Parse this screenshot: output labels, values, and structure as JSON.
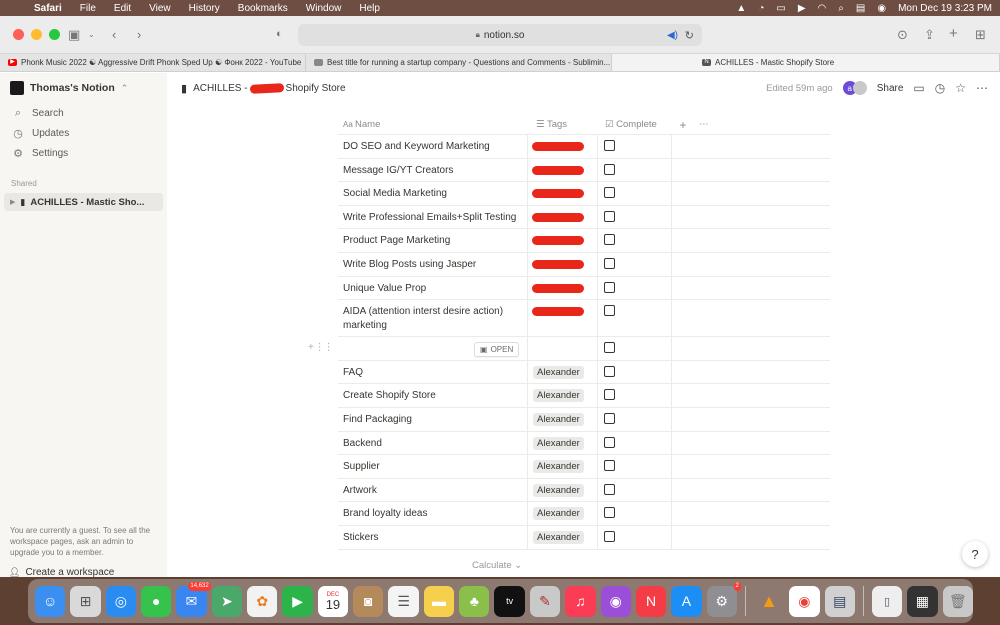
{
  "menubar": {
    "app": "Safari",
    "items": [
      "File",
      "Edit",
      "View",
      "History",
      "Bookmarks",
      "Window",
      "Help"
    ],
    "datetime": "Mon Dec 19  3:23 PM"
  },
  "browser": {
    "url": "notion.so",
    "tabs": [
      {
        "title": "Phonk Music 2022 ☯ Aggressive Drift Phonk Sped Up ☯ Фонк 2022 - YouTube",
        "favicon": "youtube-icon",
        "color": "#ff0000"
      },
      {
        "title": "Best title for running a startup company - Questions and Comments - Sublimin...",
        "favicon": "forum-icon",
        "color": "#888888"
      },
      {
        "title": "ACHILLES - Mastic Shopify Store",
        "favicon": "notion-icon",
        "color": "#555555"
      }
    ]
  },
  "sidebar": {
    "workspace": "Thomas's Notion",
    "items": [
      {
        "label": "Search",
        "icon": "search-icon"
      },
      {
        "label": "Updates",
        "icon": "clock-icon"
      },
      {
        "label": "Settings",
        "icon": "gear-icon"
      }
    ],
    "shared_label": "Shared",
    "shared_page": "ACHILLES - Mastic Sho...",
    "guest_note": "You are currently a guest. To see all the workspace pages, ask an admin to upgrade you to a member.",
    "create_workspace": "Create a workspace"
  },
  "page": {
    "breadcrumb_left": "ACHILLES -",
    "breadcrumb_right": "Shopify Store",
    "edited": "Edited 59m ago",
    "avatar_letter": "a",
    "share": "Share"
  },
  "table": {
    "columns": {
      "name": "Name",
      "tags": "Tags",
      "complete": "Complete"
    },
    "open_label": "OPEN",
    "rows": [
      {
        "name": "DO SEO and Keyword Marketing",
        "tag": "",
        "redacted": true
      },
      {
        "name": "Message IG/YT Creators",
        "tag": "",
        "redacted": true
      },
      {
        "name": "Social Media Marketing",
        "tag": "",
        "redacted": true
      },
      {
        "name": "Write Professional Emails+Split Testing",
        "tag": "",
        "redacted": true
      },
      {
        "name": "Product Page Marketing",
        "tag": "",
        "redacted": true
      },
      {
        "name": "Write Blog Posts using Jasper",
        "tag": "",
        "redacted": true
      },
      {
        "name": "Unique Value Prop",
        "tag": "",
        "redacted": true
      },
      {
        "name": "AIDA (attention interst desire action) marketing",
        "tag": "",
        "redacted": true
      },
      {
        "name": "FAQ",
        "tag": "Alexander"
      },
      {
        "name": "Create Shopify Store",
        "tag": "Alexander"
      },
      {
        "name": "Find Packaging",
        "tag": "Alexander"
      },
      {
        "name": "Backend",
        "tag": "Alexander"
      },
      {
        "name": "Supplier",
        "tag": "Alexander"
      },
      {
        "name": "Artwork",
        "tag": "Alexander"
      },
      {
        "name": "Brand loyalty ideas",
        "tag": "Alexander"
      },
      {
        "name": "Stickers",
        "tag": "Alexander"
      }
    ],
    "calculate": "Calculate"
  },
  "dock": {
    "mail_badge": "14,632",
    "calendar_month": "DEC",
    "calendar_day": "19",
    "settings_badge": "2"
  }
}
